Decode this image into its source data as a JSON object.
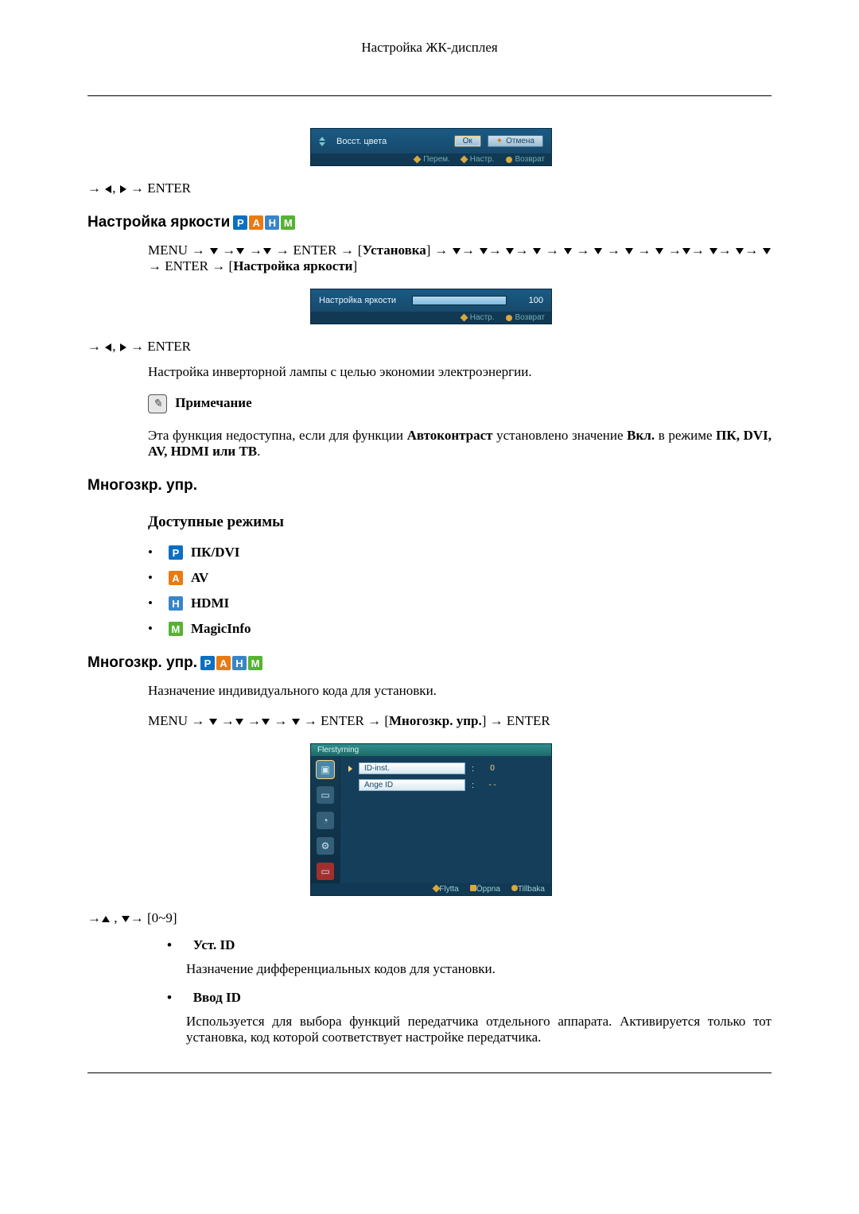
{
  "header": {
    "title": "Настройка ЖК-дисплея"
  },
  "osd_color_reset": {
    "label": "Восст. цвета",
    "ok": "Ок",
    "cancel": "Отмена",
    "footer_move": "Перем.",
    "footer_adjust": "Настр.",
    "footer_return": "Возврат"
  },
  "nav_enter_lr": "ENTER",
  "sec_brightness": {
    "title": "Настройка яркости",
    "badges": {
      "p": "P",
      "a": "A",
      "h": "H",
      "m": "M"
    },
    "path_pre": "MENU",
    "path_enter": "ENTER",
    "path_mid": "Установка",
    "path_enter2": "ENTER",
    "path_end": "Настройка яркости",
    "osd": {
      "label": "Настройка яркости",
      "value": "100",
      "fill_pct": 100,
      "footer_adjust": "Настр.",
      "footer_return": "Возврат"
    },
    "desc": "Настройка инверторной лампы с целью экономии электроэнергии.",
    "note_title": "Примечание",
    "note_text_a": "Эта функция недоступна, если для функции ",
    "note_bold_a": "Автоконтраст",
    "note_text_b": " установлено значение ",
    "note_bold_b": "Вкл.",
    "note_text_c": "в режиме ",
    "note_modes": "ПК, DVI, AV, HDMI или ТВ",
    "note_period": "."
  },
  "sec_multi": {
    "title": "Многозкр. упр.",
    "modes_title": "Доступные режимы",
    "modes": {
      "p": "ПК/DVI",
      "a": "AV",
      "h": "HDMI",
      "m": "MagicInfo"
    },
    "title2": "Многозкр. упр.",
    "desc": "Назначение индивидуального кода для установки.",
    "path_pre": "MENU",
    "path_enter": "ENTER",
    "path_mid": "Многозкр. упр.",
    "path_enter2": "ENTER",
    "osd": {
      "head": "Flerstyrning",
      "row1_label": "ID-inst.",
      "row1_val": "0",
      "row2_label": "Ange ID",
      "row2_val": "- -",
      "footer_move": "Flytta",
      "footer_open": "Öppna",
      "footer_back": "Tillbaka"
    },
    "nav_range": "[0~9]",
    "item1_title": "Уст. ID",
    "item1_text": "Назначение дифференциальных кодов для установки.",
    "item2_title": "Ввод ID",
    "item2_text": "Используется для выбора функций передатчика отдельного аппарата. Активируется только тот установка, код которой соответствует настройке передатчика."
  }
}
